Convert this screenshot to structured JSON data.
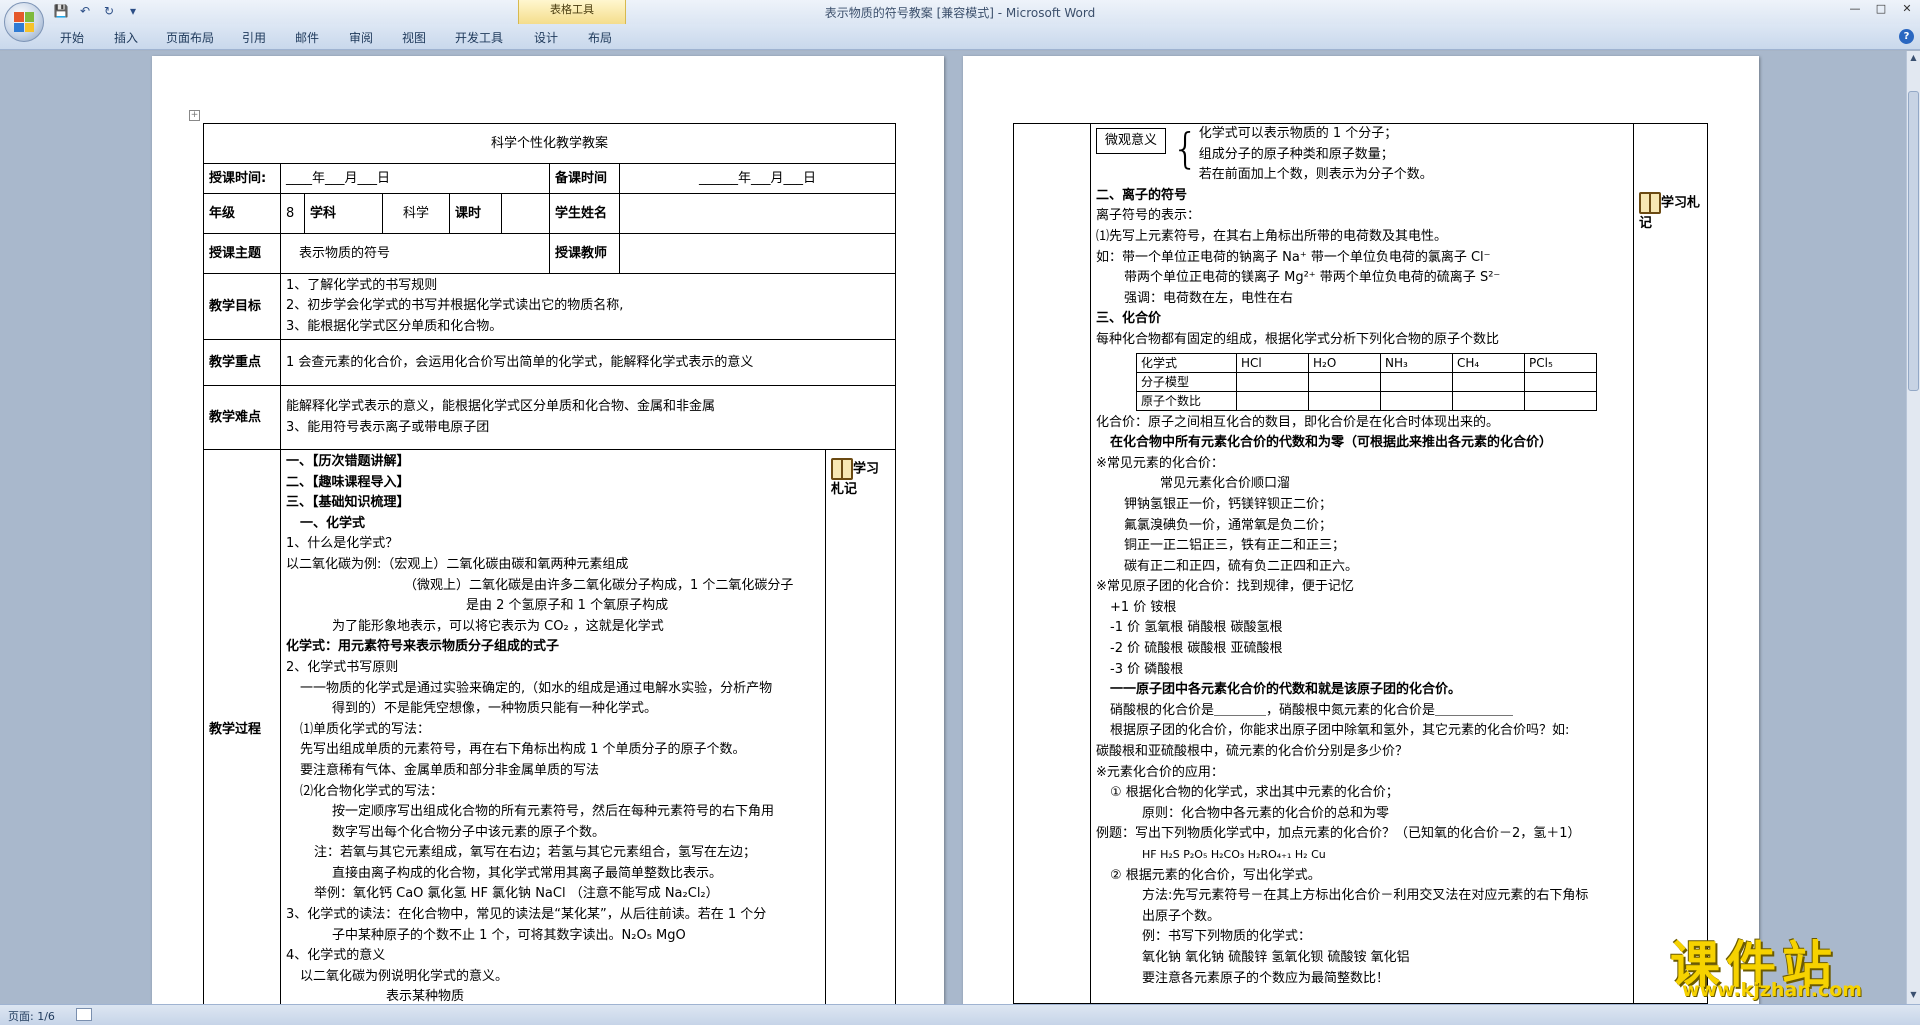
{
  "window": {
    "title": "表示物质的符号教案 [兼容模式] - Microsoft Word",
    "context_tab_group": "表格工具",
    "tabs": [
      "开始",
      "插入",
      "页面布局",
      "引用",
      "邮件",
      "审阅",
      "视图",
      "开发工具",
      "设计",
      "布局"
    ]
  },
  "status": {
    "page": "页面: 1/6"
  },
  "page1": {
    "title": "科学个性化教学教案",
    "row_time": {
      "label": "授课时间:",
      "value": "____年___月___日",
      "label2": "备课时间",
      "value2": "______年___月___日"
    },
    "row_grade": {
      "grade_label": "年级",
      "grade_value": "8",
      "subject_label": "学科",
      "subject_value": "科学",
      "hours_label": "课时",
      "student_label": "学生姓名"
    },
    "row_topic": {
      "label": "授课主题",
      "value": "表示物质的符号",
      "teacher_label": "授课教师"
    },
    "goals": {
      "label": "教学目标",
      "lines": [
        "1、了解化学式的书写规则",
        "2、初步学会化学式的书写并根据化学式读出它的物质名称,",
        "3、能根据化学式区分单质和化合物。"
      ]
    },
    "key_points": {
      "label": "教学重点",
      "text": "1 会查元素的化合价，会运用化合价写出简单的化学式，能解释化学式表示的意义"
    },
    "difficulties": {
      "label": "教学难点",
      "lines": [
        "能解释化学式表示的意义，能根据化学式区分单质和化合物、金属和非金属",
        "3、能用符号表示离子或带电原子团"
      ]
    },
    "process": {
      "label": "教学过程",
      "notes_label": "学习札记",
      "lines": [
        "一、【历次错题讲解】",
        "二、【趣味课程导入】",
        "三、【基础知识梳理】",
        "一、化学式",
        "1、什么是化学式？",
        "以二氧化碳为例:（宏观上）二氧化碳由碳和氧两种元素组成",
        "（微观上）二氧化碳是由许多二氧化碳分子构成，1 个二氧化碳分子",
        "是由 2 个氢原子和 1 个氧原子构成",
        "为了能形象地表示，可以将它表示为 CO₂ ，这就是化学式",
        "化学式：用元素符号来表示物质分子组成的式子",
        "2、化学式书写原则",
        "一一物质的化学式是通过实验来确定的,（如水的组成是通过电解水实验，分析产物",
        "得到的）不是能凭空想像，一种物质只能有一种化学式。",
        "⑴单质化学式的写法：",
        "先写出组成单质的元素符号，再在右下角标出构成 1 个单质分子的原子个数。",
        "要注意稀有气体、金属单质和部分非金属单质的写法",
        "⑵化合物化学式的写法：",
        "按一定顺序写出组成化合物的所有元素符号，然后在每种元素符号的右下角用",
        "数字写出每个化合物分子中该元素的原子个数。",
        "注：若氧与其它元素组成，氧写在右边；若氢与其它元素组合，氢写在左边；",
        "直接由离子构成的化合物，其化学式常用其离子最简单整数比表示。",
        "举例：氧化钙 CaO    氯化氢 HF    氯化钠 NaCl （注意不能写成 Na₂Cl₂）",
        "3、化学式的读法：在化合物中，常见的读法是“某化某”，从后往前读。若在 1 个分",
        "子中某种原子的个数不止 1 个，可将其数字读出。N₂O₅    MgO",
        "4、化学式的意义",
        "以二氧化碳为例说明化学式的意义。",
        "表示某种物质"
      ]
    }
  },
  "page2": {
    "notes_label": "学习札记",
    "micro": {
      "box": "微观意义",
      "lines": [
        "化学式可以表示物质的 1 个分子；",
        "组成分子的原子种类和原子数量；",
        "若在前面加上个数，则表示为分子个数。"
      ]
    },
    "lines_a": [
      "二、离子的符号",
      "离子符号的表示：",
      "⑴先写上元素符号，在其右上角标出所带的电荷数及其电性。",
      "如：带一个单位正电荷的钠离子 Na⁺   带一个单位负电荷的氯离子 Cl⁻",
      "带两个单位正电荷的镁离子 Mg²⁺   带两个单位负电荷的硫离子 S²⁻",
      "强调：电荷数在左，电性在右",
      "三、化合价",
      "每种化合物都有固定的组成，根据化学式分析下列化合物的原子个数比"
    ],
    "table": {
      "header": [
        "化学式",
        "HCl",
        "H₂O",
        "NH₃",
        "CH₄",
        "PCl₅"
      ],
      "rows": [
        [
          "分子模型",
          "",
          "",
          "",
          "",
          ""
        ],
        [
          "原子个数比",
          "",
          "",
          "",
          "",
          ""
        ]
      ]
    },
    "lines_b": [
      "化合价：原子之间相互化合的数目，即化合价是在化合时体现出来的。",
      "在化合物中所有元素化合价的代数和为零（可根据此来推出各元素的化合价）",
      "※常见元素的化合价：",
      "常见元素化合价顺口溜",
      "钾钠氢银正一价，钙镁锌钡正二价；",
      "氟氯溴碘负一价，通常氧是负二价；",
      "铜正一正二铝正三，铁有正二和正三；",
      "碳有正二和正四，硫有负二正四和正六。",
      "※常见原子团的化合价：找到规律，便于记忆",
      "+1 价   铵根",
      "-1 价   氢氧根     硝酸根     碳酸氢根",
      "-2 价   硫酸根     碳酸根     亚硫酸根",
      "-3 价   磷酸根",
      "一一原子团中各元素化合价的代数和就是该原子团的化合价。",
      "硝酸根的化合价是＿＿＿＿，硝酸根中氮元素的化合价是＿＿＿＿＿＿",
      "根据原子团的化合价，你能求出原子团中除氧和氢外，其它元素的化合价吗？如:",
      "碳酸根和亚硫酸根中，硫元素的化合价分别是多少价？",
      "※元素化合价的应用：",
      "①  根据化合物的化学式，求出其中元素的化合价；",
      "原则：化合物中各元素的化合价的总和为零",
      "例题：写出下列物质化学式中，加点元素的化合价？（已知氧的化合价－2，氢＋1）",
      "HF    H₂S    P₂O₅   H₂CO₃    H₂RO₄₊₁   H₂   Cu",
      "②  根据元素的化合价，写出化学式。",
      "方法:先写元素符号－在其上方标出化合价－利用交叉法在对应元素的右下角标",
      "出原子个数。",
      "例：书写下列物质的化学式：",
      "氧化钠  氧化钠  硫酸锌  氢氧化钡  硫酸铵  氧化铝",
      "要注意各元素原子的个数应为最简整数比！"
    ]
  },
  "watermark": {
    "main": "课件站",
    "url": "www.kjzhan.com"
  }
}
